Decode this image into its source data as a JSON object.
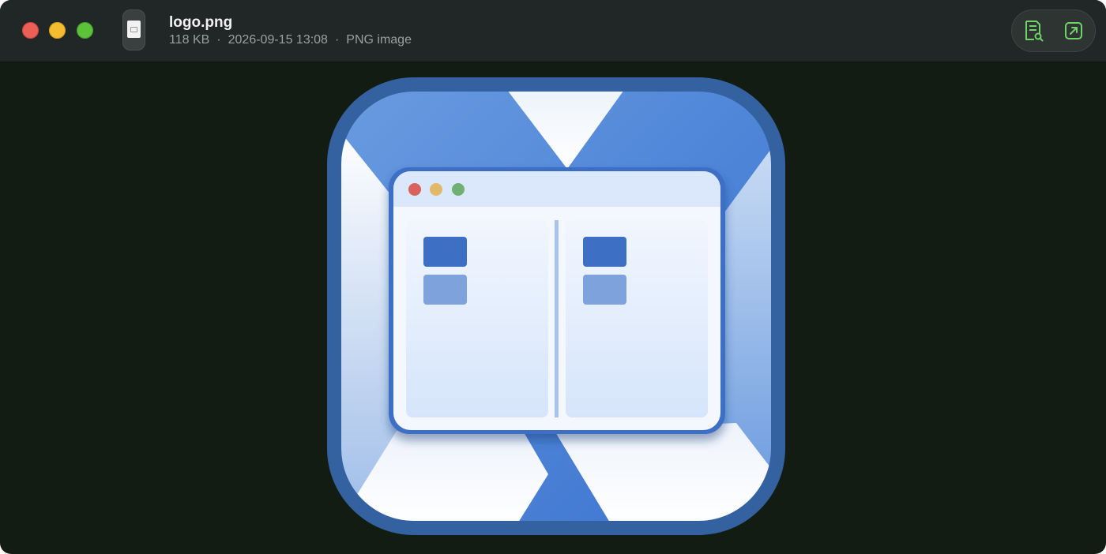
{
  "window": {
    "controls": [
      "close",
      "minimize",
      "zoom"
    ]
  },
  "file": {
    "name": "logo.png",
    "size": "118 KB",
    "modified": "2026-09-15 13:08",
    "kind": "PNG image",
    "separator": "·",
    "icon": "image-file-icon"
  },
  "toolbar": {
    "items": [
      {
        "icon": "preview-document-icon"
      },
      {
        "icon": "open-external-icon"
      }
    ],
    "accent_color": "#6fd36a"
  },
  "image": {
    "subject": "app-icon",
    "background_color": "#121c12",
    "frame_color": "#34619f",
    "accent_color": "#3d6fc4",
    "inner_window_dots": [
      "#d9625b",
      "#e2b967",
      "#6fb072"
    ]
  }
}
